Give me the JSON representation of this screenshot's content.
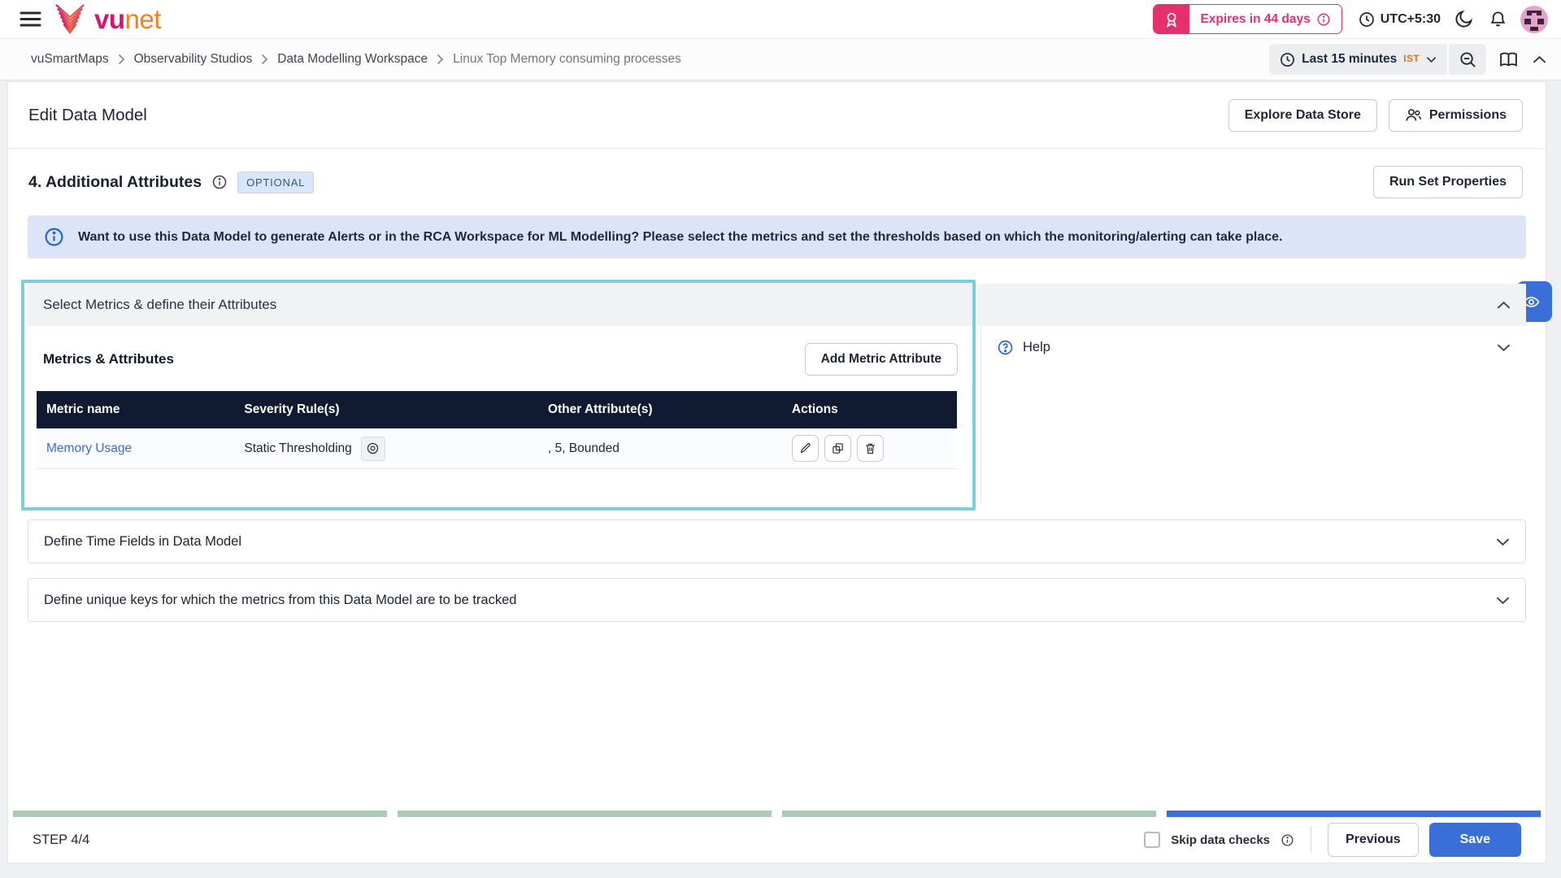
{
  "header": {
    "brand": {
      "part1": "vu",
      "part2": "net"
    },
    "license_badge": {
      "label": "Expires in 44 days"
    },
    "timezone": "UTC+5:30"
  },
  "breadcrumb": {
    "items": [
      "vuSmartMaps",
      "Observability Studios",
      "Data Modelling Workspace",
      "Linux Top Memory consuming processes"
    ]
  },
  "timebar": {
    "range_label": "Last 15 minutes",
    "timezone_abbr": "IST"
  },
  "page": {
    "title": "Edit Data Model",
    "explore_button": "Explore Data Store",
    "permissions_button": "Permissions",
    "step_heading": "4. Additional Attributes",
    "optional_badge": "OPTIONAL",
    "run_set_button": "Run Set Properties",
    "banner_text": "Want to use this Data Model to generate Alerts or in the RCA Workspace for ML Modelling? Please select the metrics and set the thresholds based on which the monitoring/alerting can take place."
  },
  "metrics_section": {
    "title": "Select Metrics & define their Attributes",
    "subtitle": "Metrics & Attributes",
    "add_button": "Add Metric Attribute",
    "help_label": "Help",
    "table": {
      "columns": [
        "Metric name",
        "Severity Rule(s)",
        "Other Attribute(s)",
        "Actions"
      ],
      "rows": [
        {
          "metric_name": "Memory Usage",
          "severity_rule": "Static Thresholding",
          "other_attributes": ", 5, Bounded"
        }
      ]
    }
  },
  "collapsibles": [
    {
      "label": "Define Time Fields in Data Model"
    },
    {
      "label": "Define unique keys for which the metrics from this Data Model are to be tracked"
    }
  ],
  "footer": {
    "step_label": "STEP 4/4",
    "skip_label": "Skip data checks",
    "previous_button": "Previous",
    "save_button": "Save",
    "progress_segments": [
      "done",
      "done",
      "done",
      "active"
    ]
  },
  "colors": {
    "accent_blue": "#3b6fd8",
    "brand_pink": "#e5306e",
    "brand_orange": "#f08121",
    "highlight_teal": "#7bcfd8",
    "table_header_navy": "#101a33",
    "progress_green": "#a9ccba",
    "banner_blue_bg": "#dce4f8",
    "optional_badge_bg": "#d9e6f8"
  }
}
